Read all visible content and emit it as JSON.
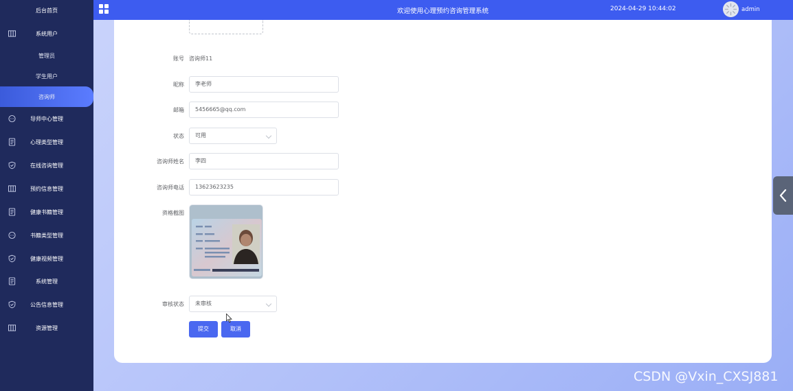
{
  "sidebar": {
    "items": [
      {
        "label": "后台首页",
        "icon": "none"
      },
      {
        "label": "系统用户",
        "icon": "columns-icon"
      },
      {
        "label": "管理员",
        "icon": "none"
      },
      {
        "label": "学生用户",
        "icon": "none"
      },
      {
        "label": "咨询师",
        "icon": "none",
        "active": true
      },
      {
        "label": "导师中心管理",
        "icon": "chat-icon"
      },
      {
        "label": "心理类型管理",
        "icon": "document-icon"
      },
      {
        "label": "在线咨询管理",
        "icon": "shield-icon"
      },
      {
        "label": "预约信息管理",
        "icon": "columns-icon"
      },
      {
        "label": "健康书籍管理",
        "icon": "document-icon"
      },
      {
        "label": "书籍类型管理",
        "icon": "chat-icon"
      },
      {
        "label": "健康视频管理",
        "icon": "shield-icon"
      },
      {
        "label": "系统管理",
        "icon": "document-icon"
      },
      {
        "label": "公告信息管理",
        "icon": "shield-icon"
      },
      {
        "label": "资源管理",
        "icon": "columns-icon"
      }
    ]
  },
  "header": {
    "title": "欢迎使用心理预约咨询管理系统",
    "datetime": "2024-04-29 10:44:02",
    "user": "admin"
  },
  "form": {
    "account_label": "账号",
    "account_value": "咨询师11",
    "nickname_label": "昵称",
    "nickname_value": "李老师",
    "email_label": "邮箱",
    "email_value": "5456665@qq.com",
    "status_label": "状态",
    "status_value": "可用",
    "name_label": "咨询师姓名",
    "name_value": "李四",
    "phone_label": "咨询师电话",
    "phone_value": "13623623235",
    "cert_label": "资格截图",
    "audit_label": "审核状态",
    "audit_value": "未审核",
    "submit_label": "提交",
    "cancel_label": "取消"
  },
  "watermark": "CSDN @Vxin_CXSJ881",
  "colors": {
    "sidebar_bg": "#1f2a5c",
    "header_bg": "#3d5cf0",
    "primary_button": "#4a68f0"
  }
}
